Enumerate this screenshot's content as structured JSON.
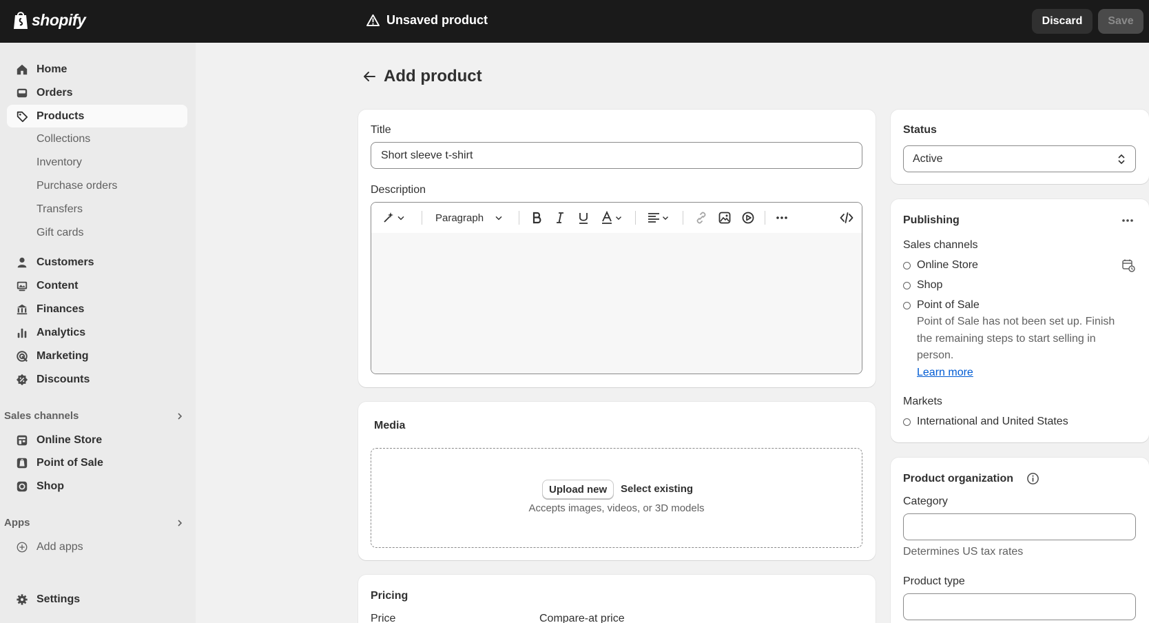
{
  "topbar": {
    "brand": "shopify",
    "unsaved_label": "Unsaved product",
    "discard_label": "Discard",
    "save_label": "Save"
  },
  "sidebar": {
    "primary": [
      {
        "label": "Home",
        "icon": "home-icon"
      },
      {
        "label": "Orders",
        "icon": "inbox-icon"
      },
      {
        "label": "Products",
        "icon": "tag-icon",
        "active": true
      }
    ],
    "products_sub": [
      "Collections",
      "Inventory",
      "Purchase orders",
      "Transfers",
      "Gift cards"
    ],
    "secondary": [
      {
        "label": "Customers",
        "icon": "person-icon"
      },
      {
        "label": "Content",
        "icon": "image-icon"
      },
      {
        "label": "Finances",
        "icon": "bank-icon"
      },
      {
        "label": "Analytics",
        "icon": "bar-chart-icon"
      },
      {
        "label": "Marketing",
        "icon": "target-icon"
      },
      {
        "label": "Discounts",
        "icon": "discount-icon"
      }
    ],
    "sales_channels_title": "Sales channels",
    "sales_channels": [
      {
        "label": "Online Store",
        "icon": "store-icon"
      },
      {
        "label": "Point of Sale",
        "icon": "pos-icon"
      },
      {
        "label": "Shop",
        "icon": "shop-icon"
      }
    ],
    "apps_title": "Apps",
    "add_apps": "Add apps",
    "settings": "Settings"
  },
  "page": {
    "title": "Add product"
  },
  "product_card": {
    "title_label": "Title",
    "title_value": "Short sleeve t-shirt",
    "description_label": "Description",
    "paragraph_label": "Paragraph"
  },
  "media": {
    "title": "Media",
    "upload_label": "Upload new",
    "select_label": "Select existing",
    "accepts": "Accepts images, videos, or 3D models"
  },
  "pricing": {
    "title": "Pricing",
    "price_label": "Price",
    "compare_label": "Compare-at price"
  },
  "status": {
    "title": "Status",
    "value": "Active"
  },
  "publishing": {
    "title": "Publishing",
    "sales_channels_label": "Sales channels",
    "channels": [
      "Online Store",
      "Shop",
      "Point of Sale"
    ],
    "pos_note": [
      "Point of Sale has not been set up. Finish",
      "the remaining steps to start selling in",
      "person."
    ],
    "learn_more": "Learn more",
    "markets_label": "Markets",
    "markets": [
      "International and United States"
    ]
  },
  "organization": {
    "title": "Product organization",
    "category_label": "Category",
    "category_value": "",
    "category_help": "Determines US tax rates",
    "type_label": "Product type",
    "type_value": ""
  }
}
